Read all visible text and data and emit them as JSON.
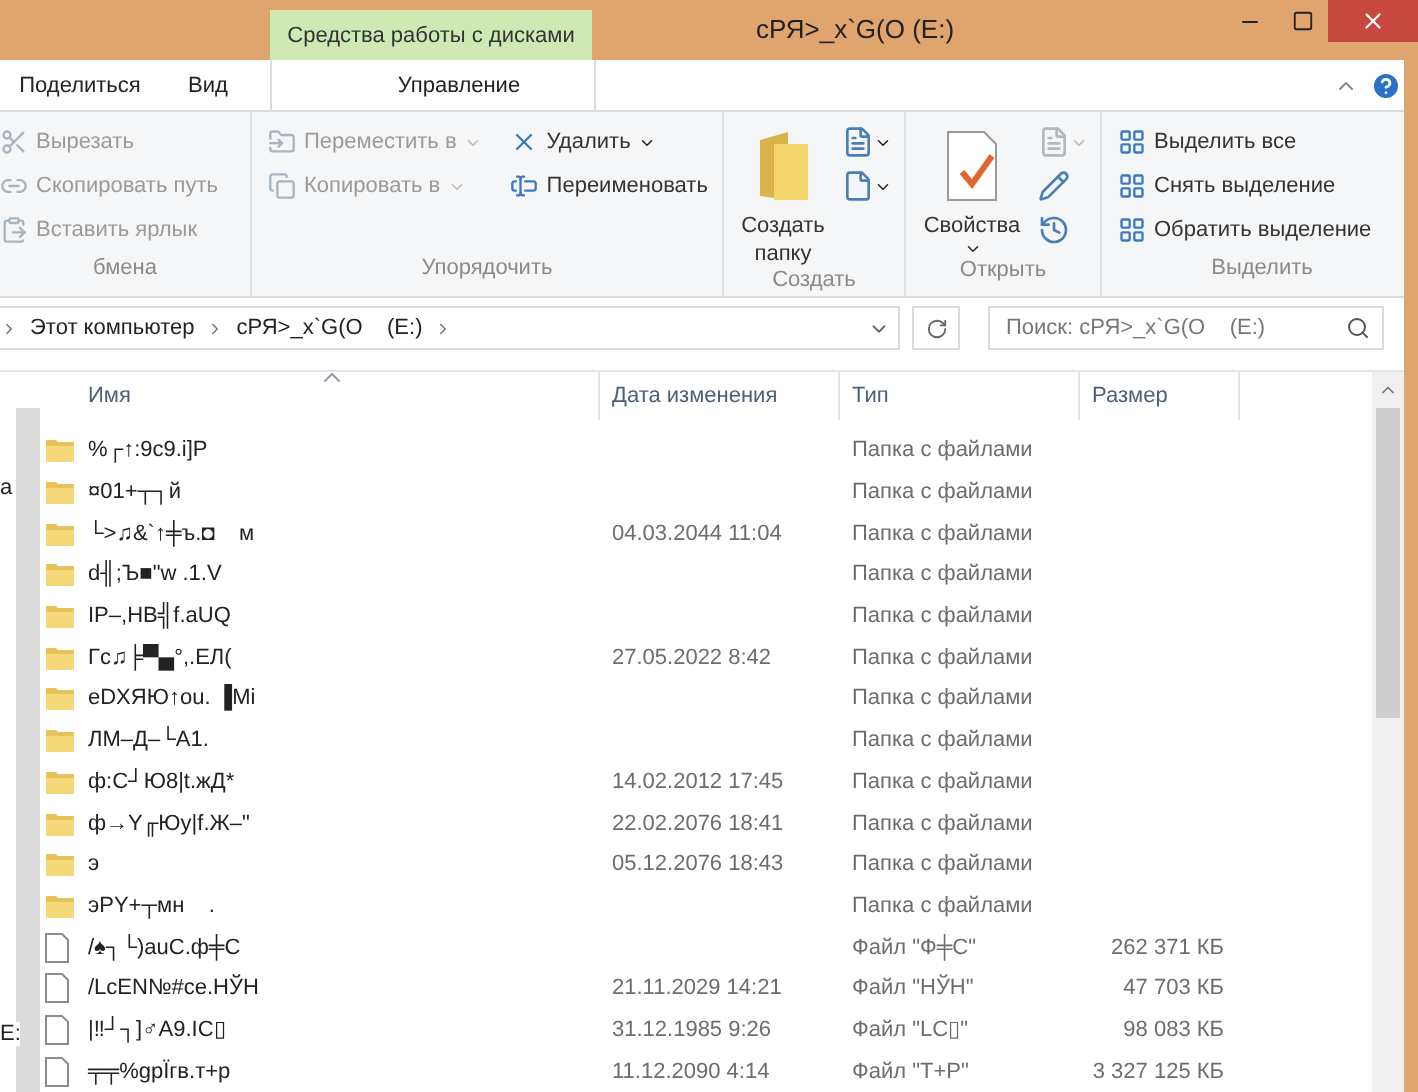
{
  "window": {
    "title": "сРЯ>_x`G(O  (E:)"
  },
  "context_tab": {
    "label": "Средства работы с дисками"
  },
  "tabs": [
    {
      "label": "Поделиться",
      "selected": false
    },
    {
      "label": "Вид",
      "selected": false
    },
    {
      "label": "Управление",
      "selected": false
    }
  ],
  "ribbon": {
    "groups": [
      {
        "label": "бмена",
        "items": [
          {
            "kind": "small",
            "label": "Вырезать",
            "disabled": true
          },
          {
            "kind": "small",
            "label": "Скопировать путь",
            "disabled": true
          },
          {
            "kind": "small",
            "label": "Вставить ярлык",
            "disabled": true
          }
        ]
      },
      {
        "label": "Упорядочить",
        "items": [
          {
            "kind": "small",
            "label": "Переместить в",
            "disabled": true,
            "dropdown": true
          },
          {
            "kind": "small",
            "label": "Копировать в",
            "disabled": true,
            "dropdown": true
          },
          {
            "kind": "small",
            "label": "Удалить",
            "disabled": false,
            "dropdown": true
          },
          {
            "kind": "small",
            "label": "Переименовать",
            "disabled": false,
            "dropdown": false
          }
        ]
      },
      {
        "label": "Создать",
        "items": [
          {
            "kind": "large",
            "label": "Создать папку",
            "dropdown": false
          },
          {
            "kind": "icon",
            "disabled": false,
            "dropdown": true
          },
          {
            "kind": "icon",
            "disabled": false,
            "dropdown": true
          }
        ]
      },
      {
        "label": "Открыть",
        "items": [
          {
            "kind": "large",
            "label": "Свойства",
            "dropdown": true
          },
          {
            "kind": "icon",
            "disabled": true,
            "dropdown": true
          },
          {
            "kind": "icon",
            "disabled": false,
            "dropdown": false
          },
          {
            "kind": "icon",
            "disabled": false,
            "dropdown": false
          }
        ]
      },
      {
        "label": "Выделить",
        "items": [
          {
            "kind": "small",
            "label": "Выделить все",
            "disabled": false
          },
          {
            "kind": "small",
            "label": "Снять выделение",
            "disabled": false
          },
          {
            "kind": "small",
            "label": "Обратить выделение",
            "disabled": false
          }
        ]
      }
    ]
  },
  "address": {
    "crumbs": [
      "Этот компьютер",
      "сРЯ>_x`G(O    (E:)"
    ]
  },
  "search": {
    "placeholder": "Поиск: сРЯ>_x`G(O    (E:)"
  },
  "nav_pane": {
    "items": [
      "а",
      "E:"
    ]
  },
  "table": {
    "columns": [
      "Имя",
      "Дата изменения",
      "Тип",
      "Размер"
    ],
    "rows": [
      {
        "kind": "folder",
        "name": "%┌↑:9c9.i]P",
        "date": "",
        "type": "Папка с файлами",
        "size": ""
      },
      {
        "kind": "folder",
        "name": "¤01+┬┐й",
        "date": "",
        "type": "Папка с файлами",
        "size": ""
      },
      {
        "kind": "folder",
        "name": "└>♫&`↑╪ъ.◘    м",
        "date": "04.03.2044 11:04",
        "type": "Папка с файлами",
        "size": ""
      },
      {
        "kind": "folder",
        "name": "d╢;Ъ■\"w .1.V",
        "date": "",
        "type": "Папка с файлами",
        "size": ""
      },
      {
        "kind": "folder",
        "name": "IP–,HB╣f.aUQ",
        "date": "",
        "type": "Папка с файлами",
        "size": ""
      },
      {
        "kind": "folder",
        "name": "Гс♫╞▀▄°,.ЕЛ(",
        "date": "27.05.2022 8:42",
        "type": "Папка с файлами",
        "size": ""
      },
      {
        "kind": "folder",
        "name": "eDXЯЮ↑ou. ▐Mi",
        "date": "",
        "type": "Папка с файлами",
        "size": ""
      },
      {
        "kind": "folder",
        "name": "ЛМ–Д–└A1.",
        "date": "",
        "type": "Папка с файлами",
        "size": ""
      },
      {
        "kind": "folder",
        "name": "ф:С┘Ю8|t.жД*",
        "date": "14.02.2012 17:45",
        "type": "Папка с файлами",
        "size": ""
      },
      {
        "kind": "folder",
        "name": "ф→Y╓Юy|f.Ж–\"",
        "date": "22.02.2076 18:41",
        "type": "Папка с файлами",
        "size": ""
      },
      {
        "kind": "folder",
        "name": "э",
        "date": "05.12.2076 18:43",
        "type": "Папка с файлами",
        "size": ""
      },
      {
        "kind": "folder",
        "name": "эPY+┬мн    .",
        "date": "",
        "type": "Папка с файлами",
        "size": ""
      },
      {
        "kind": "file",
        "name": "/♠┐└)auC.ф╪C",
        "date": "",
        "type": "Файл \"Ф╪С\"",
        "size": "262 371 КБ"
      },
      {
        "kind": "file",
        "name": "/LcEN№#ce.НЎН",
        "date": "21.11.2029 14:21",
        "type": "Файл \"НЎН\"",
        "size": "47 703 КБ"
      },
      {
        "kind": "file",
        "name": "|‼┘┐]♂A9.IC▯",
        "date": "31.12.1985 9:26",
        "type": "Файл \"LC▯\"",
        "size": "98 083 КБ"
      },
      {
        "kind": "file",
        "name": "╤╤%gpÏгв.т+р",
        "date": "11.12.2090 4:14",
        "type": "Файл \"Т+Р\"",
        "size": "3 327 125 КБ"
      }
    ]
  }
}
